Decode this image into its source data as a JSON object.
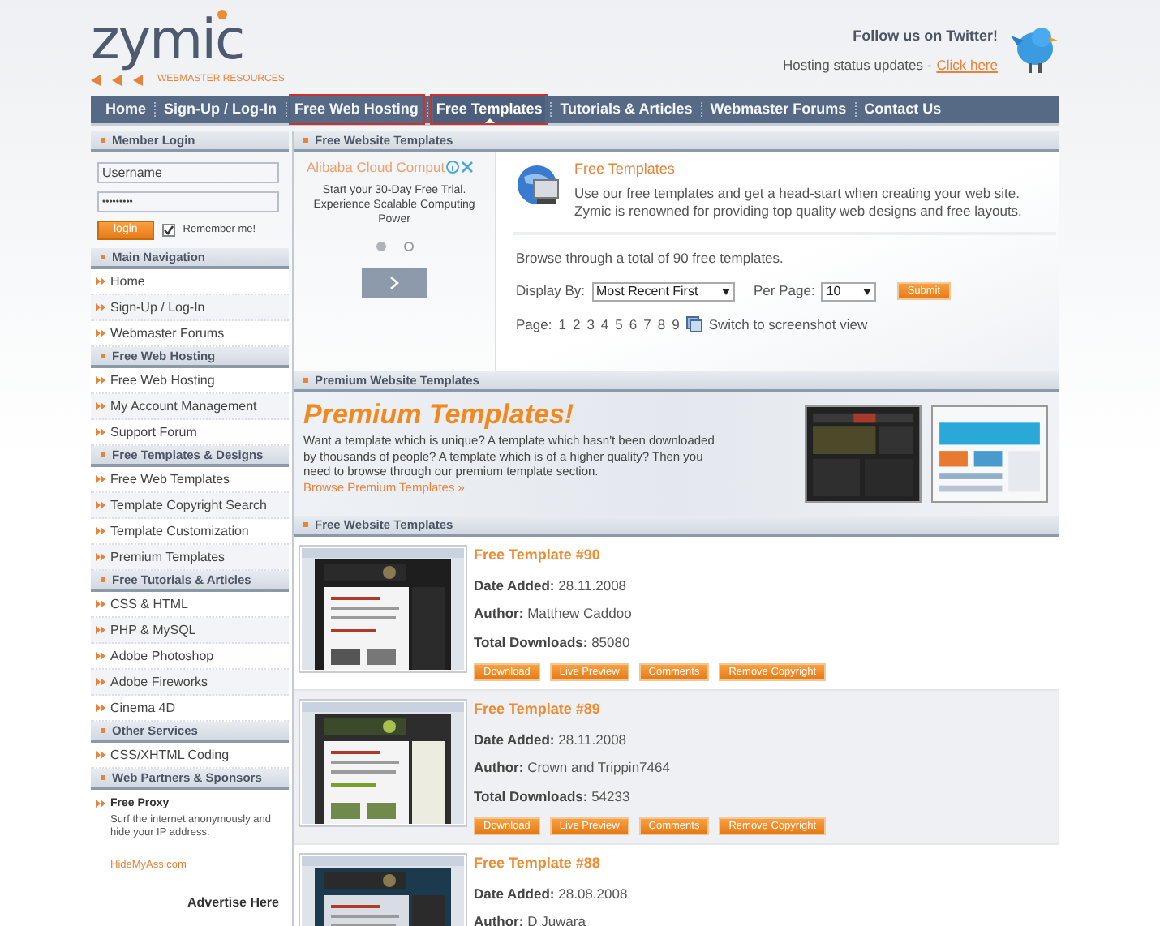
{
  "logo": {
    "name": "zymic",
    "tagline": "WEBMASTER RESOURCES"
  },
  "twitter": {
    "heading": "Follow us on Twitter!",
    "text": "Hosting status updates -",
    "link": "Click here"
  },
  "nav": [
    {
      "label": "Home",
      "selected": false,
      "highlighted": false
    },
    {
      "label": "Sign-Up / Log-In",
      "selected": false,
      "highlighted": false
    },
    {
      "label": "Free Web Hosting",
      "selected": false,
      "highlighted": true
    },
    {
      "label": "Free Templates",
      "selected": true,
      "highlighted": true
    },
    {
      "label": "Tutorials & Articles",
      "selected": false,
      "highlighted": false
    },
    {
      "label": "Webmaster Forums",
      "selected": false,
      "highlighted": false
    },
    {
      "label": "Contact Us",
      "selected": false,
      "highlighted": false
    }
  ],
  "sidebar": {
    "login": {
      "title": "Member Login",
      "username": "Username",
      "password": "•••••••••",
      "button": "login",
      "remember": {
        "label": "Remember me!",
        "checked": true
      }
    },
    "sections": [
      {
        "title": "Main Navigation",
        "items": [
          "Home",
          "Sign-Up / Log-In",
          "Webmaster Forums"
        ]
      },
      {
        "title": "Free Web Hosting",
        "items": [
          "Free Web Hosting",
          "My Account Management",
          "Support Forum"
        ]
      },
      {
        "title": "Free Templates & Designs",
        "items": [
          "Free Web Templates",
          "Template Copyright Search",
          "Template Customization",
          "Premium Templates"
        ]
      },
      {
        "title": "Free Tutorials & Articles",
        "items": [
          "CSS & HTML",
          "PHP & MySQL",
          "Adobe Photoshop",
          "Adobe Fireworks",
          "Cinema 4D"
        ]
      },
      {
        "title": "Other Services",
        "items": [
          "CSS/XHTML Coding"
        ]
      }
    ],
    "sponsors": {
      "title": "Web Partners & Sponsors",
      "name": "Free Proxy",
      "text": "Surf the internet anonymously and hide your IP address.",
      "link": "HideMyAss.com"
    },
    "advertise": "Advertise Here"
  },
  "main": {
    "intro_header": "Free Website Templates",
    "ad": {
      "title": "Alibaba Cloud Comput",
      "text": "Start your 30-Day Free Trial. Experience Scalable Computing Power",
      "dots": [
        {
          "selected": true
        },
        {
          "selected": false
        }
      ]
    },
    "intro": {
      "title": "Free Templates",
      "text": "Use our free templates and get a head-start when creating your web site. Zymic is renowned for providing top quality web designs and free layouts.",
      "browse": "Browse through a total of 90 free templates.",
      "display_label": "Display By:",
      "display_value": "Most Recent First",
      "per_page_label": "Per Page:",
      "per_page_value": "10",
      "submit": "Submit",
      "page_label": "Page:",
      "pages": [
        "1",
        "2",
        "3",
        "4",
        "5",
        "6",
        "7",
        "8",
        "9"
      ],
      "switch": "Switch to screenshot view"
    },
    "premium": {
      "header": "Premium Website Templates",
      "title": "Premium Templates!",
      "text": "Want a template which is unique? A template which hasn't been downloaded by thousands of people? A template which is of a higher quality? Then you need to browse through our premium template section.",
      "link": "Browse Premium Templates »"
    },
    "list_header": "Free Website Templates",
    "templates": [
      {
        "title": "Free Template #90",
        "fields": [
          {
            "label": "Date Added:",
            "value": "28.11.2008"
          },
          {
            "label": "Author:",
            "value": "Matthew Caddoo"
          },
          {
            "label": "Total Downloads:",
            "value": "85080"
          }
        ],
        "buttons": [
          "Download",
          "Live Preview",
          "Comments",
          "Remove Copyright"
        ]
      },
      {
        "title": "Free Template #89",
        "fields": [
          {
            "label": "Date Added:",
            "value": "28.11.2008"
          },
          {
            "label": "Author:",
            "value": "Crown and Trippin7464"
          },
          {
            "label": "Total Downloads:",
            "value": "54233"
          }
        ],
        "buttons": [
          "Download",
          "Live Preview",
          "Comments",
          "Remove Copyright"
        ]
      },
      {
        "title": "Free Template #88",
        "fields": [
          {
            "label": "Date Added:",
            "value": "28.08.2008"
          },
          {
            "label": "Author:",
            "value": "D Juwara"
          }
        ]
      }
    ]
  }
}
